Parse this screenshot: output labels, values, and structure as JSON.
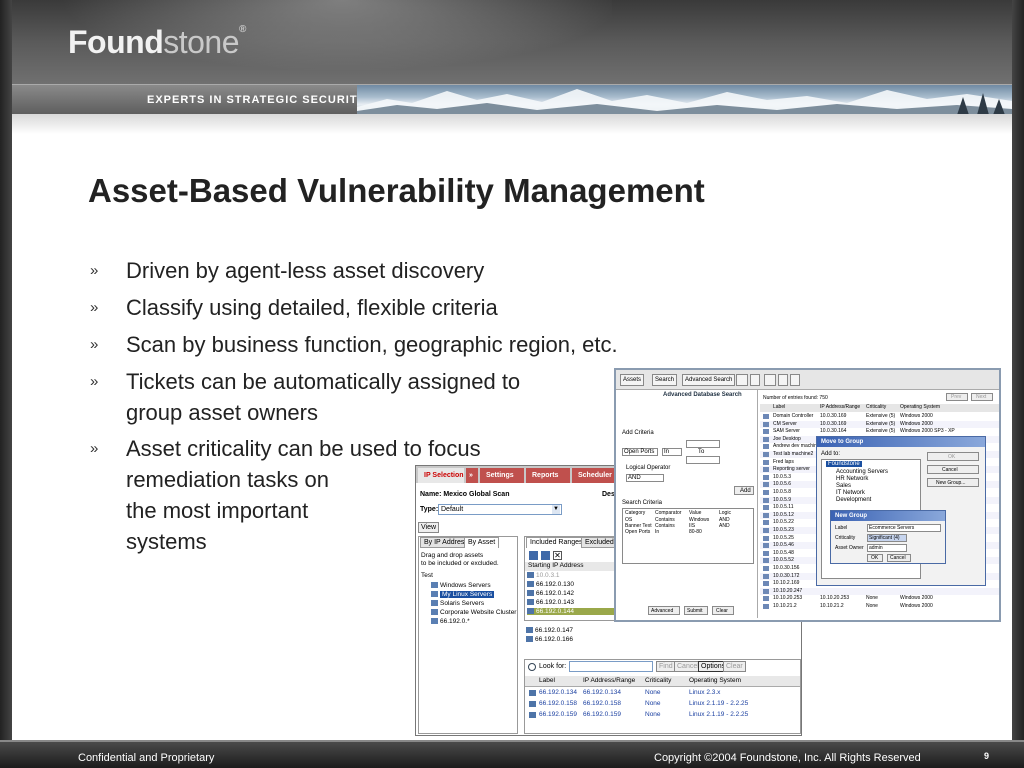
{
  "header": {
    "logo_bold": "Found",
    "logo_light": "stone",
    "logo_tm": "®",
    "tagline": "EXPERTS IN STRATEGIC SECURITY"
  },
  "slide": {
    "title": "Asset-Based Vulnerability Management",
    "bullet_mark": "»",
    "bullets": [
      {
        "lines": [
          "Driven by agent-less asset discovery"
        ]
      },
      {
        "lines": [
          "Classify using detailed, flexible criteria"
        ]
      },
      {
        "lines": [
          "Scan by business function, geographic region, etc."
        ]
      },
      {
        "lines": [
          "Tickets can be automatically assigned to",
          "group asset owners"
        ]
      },
      {
        "lines": [
          "Asset criticality can be used to focus",
          "remediation tasks on",
          "the most important",
          "systems"
        ]
      }
    ]
  },
  "scan_window": {
    "tabs": [
      "IP Selection",
      "»",
      "Settings",
      "Reports",
      "Scheduler"
    ],
    "desc_label": "Desc",
    "name_row": "Name: Mexico Global Scan",
    "type_label": "Type:",
    "type_value": "Default",
    "view_button": "View",
    "left_tabs": [
      "By IP Address",
      "By Asset"
    ],
    "hint_line1": "Drag and drop assets",
    "hint_line2": "to be included or excluded.",
    "tree_root": "Test",
    "tree_items": [
      "Windows Servers",
      "My Linux Servers",
      "Solaris Servers",
      "Corporate Website Cluster",
      "66.192.0.*"
    ],
    "right_tabs": [
      "Included Ranges",
      "Excluded Ra"
    ],
    "column_header": "Starting IP Address",
    "ip_rows": [
      "10.0.3.1",
      "66.192.0.130",
      "66.192.0.142",
      "66.192.0.143",
      "66.192.0.144",
      "66.192.0.147",
      "66.192.0.166"
    ],
    "look_for_label": "Look for:",
    "find_buttons": [
      "Find",
      "Cancel",
      "Options",
      "Clear"
    ],
    "table_headers": [
      "Label",
      "IP Address/Range",
      "Criticality",
      "Operating System"
    ],
    "table_rows": [
      [
        "66.192.0.134",
        "66.192.0.134",
        "None",
        "Linux 2.3.x"
      ],
      [
        "66.192.0.158",
        "66.192.0.158",
        "None",
        "Linux 2.1.19 - 2.2.25"
      ],
      [
        "66.192.0.159",
        "66.192.0.159",
        "None",
        "Linux 2.1.19 - 2.2.25"
      ]
    ]
  },
  "asset_window": {
    "toolbar": [
      "Assets",
      "Search",
      "Advanced Search"
    ],
    "panel_title": "Advanced Database Search",
    "add_criteria": "Add Criteria",
    "open_ports": "Open Ports",
    "in": "In",
    "to": "To",
    "logical_operator": "Logical Operator",
    "and": "AND",
    "add_button": "Add",
    "search_criteria": "Search Criteria",
    "criteria_headers": [
      "Category",
      "Comparator",
      "Value",
      "Logic"
    ],
    "criteria_rows": [
      [
        "OS",
        "Contains",
        "Windows",
        "AND"
      ],
      [
        "Banner Text",
        "Contains",
        "IIS",
        "AND"
      ],
      [
        "Open Ports",
        "In",
        "80-80",
        ""
      ]
    ],
    "bottom_buttons": [
      "Advanced",
      "Submit",
      "Clear"
    ],
    "entries_found": "Number of entries found: 750",
    "nav_buttons": [
      "Prev",
      "Next"
    ],
    "grid_headers": [
      "Label",
      "IP Address/Range",
      "Criticality",
      "Operating System"
    ],
    "grid_rows": [
      [
        "Domain Controller",
        "10.0.30.169",
        "Extensive (5)",
        "Windows 2000"
      ],
      [
        "CM Server",
        "10.0.30.169",
        "Extensive (5)",
        "Windows 2000"
      ],
      [
        "SAM Server",
        "10.0.30.164",
        "Extensive (5)",
        "Windows 2000 SP3 - XP"
      ],
      [
        "Joe Desktop",
        "",
        "",
        ""
      ],
      [
        "Andrew dev machine",
        "",
        "",
        ""
      ],
      [
        "Test lab machine2",
        "",
        "",
        ""
      ],
      [
        "Fred laps",
        "",
        "",
        ""
      ],
      [
        "Reporting server",
        "",
        "",
        ""
      ],
      [
        "10.0.5.3",
        "",
        "",
        ""
      ],
      [
        "10.0.5.6",
        "",
        "",
        ""
      ],
      [
        "10.0.5.8",
        "",
        "",
        ""
      ],
      [
        "10.0.5.9",
        "",
        "",
        ""
      ],
      [
        "10.0.5.11",
        "",
        "",
        ""
      ],
      [
        "10.0.5.12",
        "",
        "",
        ""
      ],
      [
        "10.0.5.22",
        "",
        "",
        ""
      ],
      [
        "10.0.5.23",
        "",
        "",
        ""
      ],
      [
        "10.0.5.25",
        "",
        "",
        ""
      ],
      [
        "10.0.5.46",
        "",
        "",
        ""
      ],
      [
        "10.0.5.48",
        "",
        "",
        ""
      ],
      [
        "10.0.5.52",
        "",
        "",
        ""
      ],
      [
        "10.0.30.156",
        "",
        "",
        ""
      ],
      [
        "10.0.30.172",
        "",
        "",
        ""
      ],
      [
        "10.10.2.169",
        "",
        "",
        ""
      ],
      [
        "10.10.20.247",
        "",
        "",
        ""
      ],
      [
        "10.10.20.253",
        "10.10.20.253",
        "None",
        "Windows 2000"
      ],
      [
        "10.10.21.2",
        "10.10.21.2",
        "None",
        "Windows 2000"
      ]
    ],
    "move_dialog": {
      "title": "Move to Group",
      "add_to": "Add to:",
      "tree": [
        "Foundstone",
        "Accounting Servers",
        "HR Network",
        "Sales",
        "IT Network",
        "Development"
      ],
      "buttons": [
        "OK",
        "Cancel",
        "New Group..."
      ]
    },
    "new_group_dialog": {
      "title": "New Group",
      "label_lbl": "Label",
      "label_val": "Ecommerce Servers",
      "crit_lbl": "Criticality",
      "crit_val": "Significant (4)",
      "owner_lbl": "Asset Owner",
      "owner_val": "admin",
      "buttons": [
        "OK",
        "Cancel"
      ]
    }
  },
  "footer": {
    "left": "Confidential and Proprietary",
    "right": "Copyright ©2004 Foundstone, Inc. All Rights Reserved",
    "page": "9"
  }
}
